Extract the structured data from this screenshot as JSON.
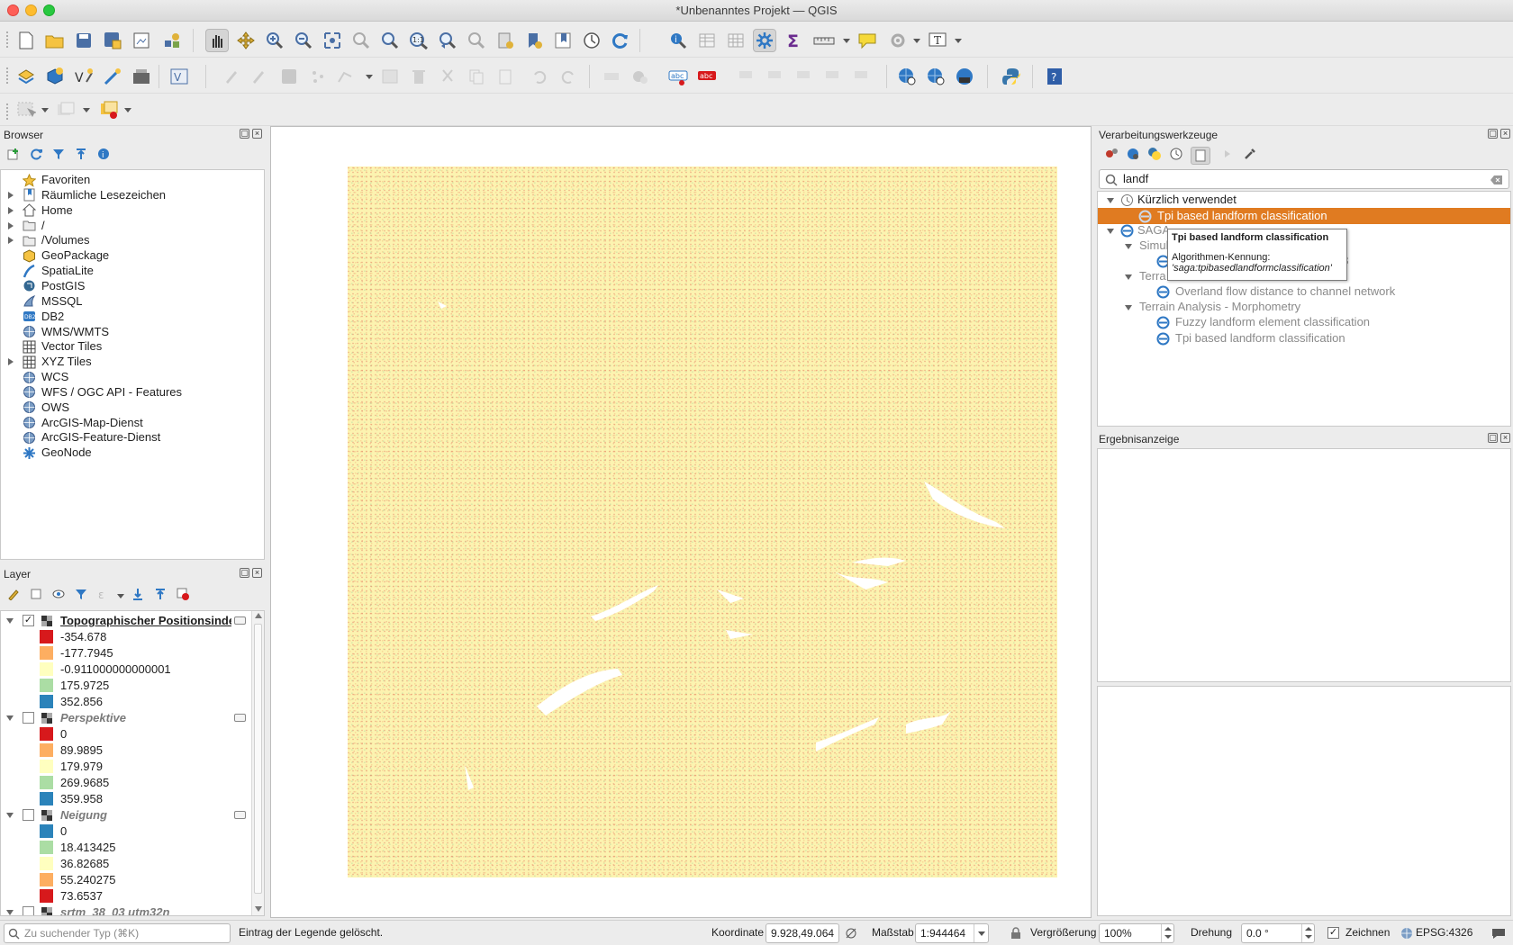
{
  "window": {
    "title": "*Unbenanntes Projekt — QGIS"
  },
  "browser": {
    "title": "Browser",
    "items": [
      {
        "label": "Favoriten",
        "expandable": false,
        "icon": "star-icon"
      },
      {
        "label": "Räumliche Lesezeichen",
        "expandable": true,
        "icon": "bookmark-icon"
      },
      {
        "label": "Home",
        "expandable": true,
        "icon": "home-icon"
      },
      {
        "label": "/",
        "expandable": true,
        "icon": "folder-icon"
      },
      {
        "label": "/Volumes",
        "expandable": true,
        "icon": "folder-icon"
      },
      {
        "label": "GeoPackage",
        "expandable": false,
        "icon": "geopackage-icon"
      },
      {
        "label": "SpatiaLite",
        "expandable": false,
        "icon": "spatialite-icon"
      },
      {
        "label": "PostGIS",
        "expandable": false,
        "icon": "postgis-icon"
      },
      {
        "label": "MSSQL",
        "expandable": false,
        "icon": "mssql-icon"
      },
      {
        "label": "DB2",
        "expandable": false,
        "icon": "db2-icon"
      },
      {
        "label": "WMS/WMTS",
        "expandable": false,
        "icon": "globe-icon"
      },
      {
        "label": "Vector Tiles",
        "expandable": false,
        "icon": "grid-icon"
      },
      {
        "label": "XYZ Tiles",
        "expandable": true,
        "icon": "grid-icon"
      },
      {
        "label": "WCS",
        "expandable": false,
        "icon": "globe-icon"
      },
      {
        "label": "WFS / OGC API - Features",
        "expandable": false,
        "icon": "globe-icon"
      },
      {
        "label": "OWS",
        "expandable": false,
        "icon": "globe-icon"
      },
      {
        "label": "ArcGIS-Map-Dienst",
        "expandable": false,
        "icon": "globe-icon"
      },
      {
        "label": "ArcGIS-Feature-Dienst",
        "expandable": false,
        "icon": "globe-icon"
      },
      {
        "label": "GeoNode",
        "expandable": false,
        "icon": "geonode-icon"
      }
    ]
  },
  "layers": {
    "title": "Layer",
    "groups": [
      {
        "name": "Topographischer Positionsinde",
        "checked": true,
        "entries": [
          {
            "value": "-354.678",
            "color": "#d7191c"
          },
          {
            "value": "-177.7945",
            "color": "#fdae61"
          },
          {
            "value": "-0.911000000000001",
            "color": "#ffffbf"
          },
          {
            "value": "175.9725",
            "color": "#abdda4"
          },
          {
            "value": "352.856",
            "color": "#2b83ba"
          }
        ]
      },
      {
        "name": "Perspektive",
        "checked": false,
        "entries": [
          {
            "value": "0",
            "color": "#d7191c"
          },
          {
            "value": "89.9895",
            "color": "#fdae61"
          },
          {
            "value": "179.979",
            "color": "#ffffbf"
          },
          {
            "value": "269.9685",
            "color": "#abdda4"
          },
          {
            "value": "359.958",
            "color": "#2b83ba"
          }
        ]
      },
      {
        "name": "Neigung",
        "checked": false,
        "entries": [
          {
            "value": "0",
            "color": "#2b83ba"
          },
          {
            "value": "18.413425",
            "color": "#abdda4"
          },
          {
            "value": "36.82685",
            "color": "#ffffbf"
          },
          {
            "value": "55.240275",
            "color": "#fdae61"
          },
          {
            "value": "73.6537",
            "color": "#d7191c"
          }
        ]
      },
      {
        "name": "srtm_38_03 utm32n",
        "checked": false,
        "entries": []
      }
    ]
  },
  "processing": {
    "title": "Verarbeitungswerkzeuge",
    "search_value": "landf",
    "recent_label": "Kürzlich verwendet",
    "recent_item": "Tpi based landform classification",
    "saga_label": "SAGA",
    "sim_label": "Simul",
    "sim_item_suffix": "d8",
    "terrain_hydro_label": "Terra",
    "overland_item": "Overland flow distance to channel network",
    "morph_label": "Terrain Analysis - Morphometry",
    "fuzzy_item": "Fuzzy landform element classification",
    "tpi_item": "Tpi based landform classification"
  },
  "tooltip": {
    "title": "Tpi based landform classification",
    "id_label": "Algorithmen-Kennung:",
    "id_value": "'saga:tpibasedlandformclassification'"
  },
  "results": {
    "title": "Ergebnisanzeige"
  },
  "statusbar": {
    "locator_placeholder": "Zu suchender Typ (⌘K)",
    "message": "Eintrag der Legende gelöscht.",
    "coord_label": "Koordinate",
    "coord_value": "9.928,49.064",
    "scale_label": "Maßstab",
    "scale_value": "1:944464",
    "magnifier_label": "Vergrößerung",
    "magnifier_value": "100%",
    "rotation_label": "Drehung",
    "rotation_value": "0.0 °",
    "render_label": "Zeichnen",
    "crs": "EPSG:4326"
  },
  "colors": {
    "highlight": "#e07b21",
    "raster_base": "#fcf3b0"
  }
}
